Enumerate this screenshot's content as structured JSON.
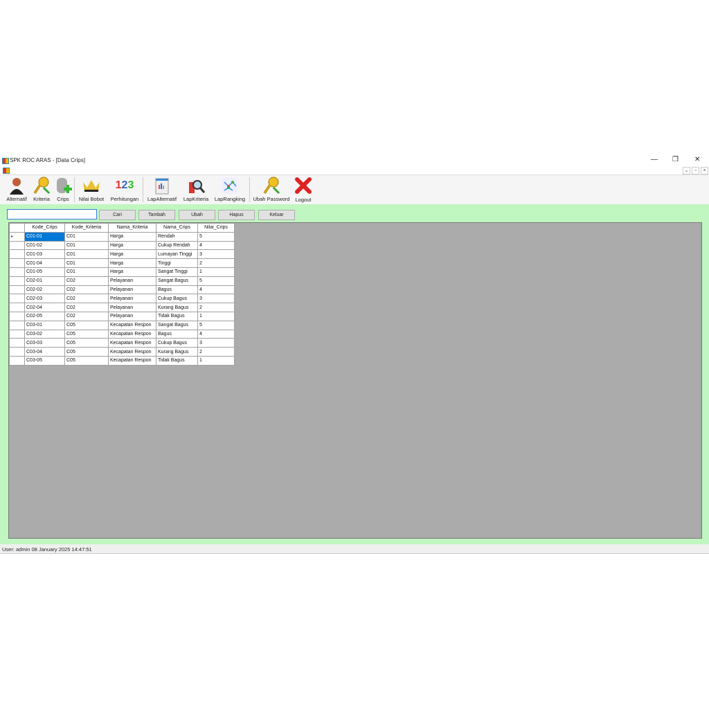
{
  "window": {
    "title": "SPK ROC ARAS - [Data Crips]",
    "minimize": "—",
    "restore": "❐",
    "close": "✕",
    "mdi_min": "⌄",
    "mdi_restore": "▫",
    "mdi_close": "×"
  },
  "toolbar": [
    {
      "label": "Alternatif",
      "icon": "user-icon"
    },
    {
      "label": "Kriteria",
      "icon": "key-icon"
    },
    {
      "label": "Crips",
      "icon": "database-add-icon"
    },
    {
      "label": "Nilai Bobot",
      "icon": "crown-icon"
    },
    {
      "label": "Perhitungan",
      "icon": "numbers-icon",
      "glyph": "123"
    },
    {
      "label": "LapAlternatif",
      "icon": "report-icon"
    },
    {
      "label": "LapKriteria",
      "icon": "magnifier-report-icon"
    },
    {
      "label": "LapRangking",
      "icon": "chart-icon"
    },
    {
      "label": "Ubah Password",
      "icon": "key-icon"
    },
    {
      "label": "Logout",
      "icon": "close-x-icon"
    }
  ],
  "actions": {
    "search_value": "",
    "cari": "Cari",
    "tambah": "Tambah",
    "ubah": "Ubah",
    "hapus": "Hapus",
    "keluar": "Keluar"
  },
  "table": {
    "columns": [
      "Kode_Crips",
      "Kode_Kriteria",
      "Nama_Kriteria",
      "Nama_Crips",
      "Nilai_Crips"
    ],
    "rows": [
      [
        "C01-01",
        "C01",
        "Harga",
        "Rendah",
        "5"
      ],
      [
        "C01-02",
        "C01",
        "Harga",
        "Cukup Rendah",
        "4"
      ],
      [
        "C01-03",
        "C01",
        "Harga",
        "Lumayan Tinggi",
        "3"
      ],
      [
        "C01-04",
        "C01",
        "Harga",
        "Tinggi",
        "2"
      ],
      [
        "C01-05",
        "C01",
        "Harga",
        "Sangat Tinggi",
        "1"
      ],
      [
        "C02-01",
        "C02",
        "Pelayanan",
        "Sangat Bagus",
        "5"
      ],
      [
        "C02-02",
        "C02",
        "Pelayanan",
        "Bagus",
        "4"
      ],
      [
        "C02-03",
        "C02",
        "Pelayanan",
        "Cukup Bagus",
        "3"
      ],
      [
        "C02-04",
        "C02",
        "Pelayanan",
        "Kurang Bagus",
        "2"
      ],
      [
        "C02-05",
        "C02",
        "Pelayanan",
        "Tidak Bagus",
        "1"
      ],
      [
        "C03-01",
        "C05",
        "Kecapatan Respon",
        "Sangat Bagus",
        "5"
      ],
      [
        "C03-02",
        "C05",
        "Kecapatan Respon",
        "Bagus",
        "4"
      ],
      [
        "C03-03",
        "C05",
        "Kecapatan Respon",
        "Cukup Bagus",
        "3"
      ],
      [
        "C03-04",
        "C05",
        "Kecapatan Respon",
        "Kurang Bagus",
        "2"
      ],
      [
        "C03-05",
        "C05",
        "Kecapatan Respon",
        "Tidak Bagus",
        "1"
      ]
    ]
  },
  "status": "User: admin  08 January 2025 14:47:51"
}
